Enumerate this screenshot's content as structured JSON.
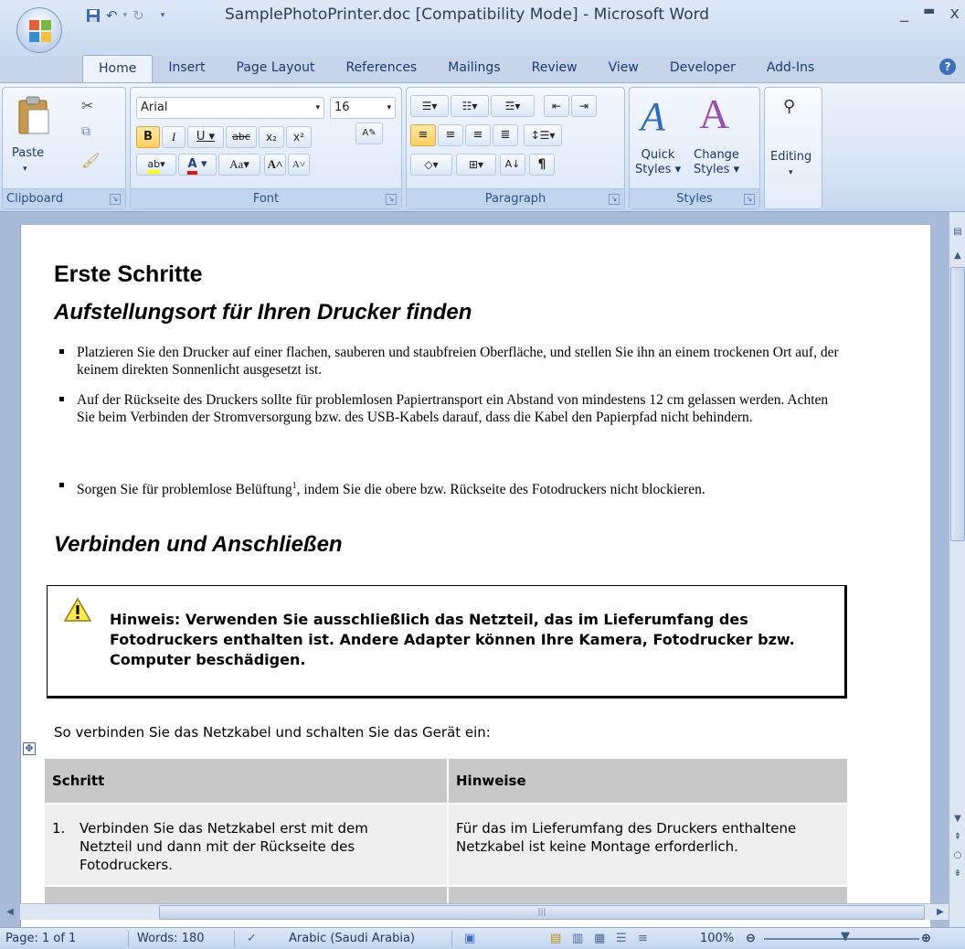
{
  "window": {
    "title": "SamplePhotoPrinter.doc [Compatibility Mode] - Microsoft Word",
    "controls": [
      "_",
      "▭",
      "x"
    ]
  },
  "tabs": [
    "Home",
    "Insert",
    "Page Layout",
    "References",
    "Mailings",
    "Review",
    "View",
    "Developer",
    "Add-Ins"
  ],
  "ribbon": {
    "clipboard": {
      "paste": "Paste",
      "label": "Clipboard"
    },
    "font": {
      "name": "Arial",
      "size": "16",
      "label": "Font",
      "aa": "Aa"
    },
    "paragraph": {
      "label": "Paragraph"
    },
    "styles": {
      "quick_line1": "Quick",
      "quick_line2": "Styles",
      "change_line1": "Change",
      "change_line2": "Styles",
      "label": "Styles"
    },
    "editing": {
      "label": "Editing"
    }
  },
  "document": {
    "heading1": "Erste Schritte",
    "heading2a": "Aufstellungsort für Ihren Drucker finden",
    "bullets": [
      "Platzieren Sie den Drucker auf einer flachen, sauberen und staubfreien Oberfläche, und stellen Sie ihn an einem trockenen Ort auf, der keinem direkten Sonnenlicht ausgesetzt ist.",
      "Auf der Rückseite des Druckers sollte für problemlosen Papiertransport ein Abstand von mindestens 12 cm gelassen werden. Achten Sie beim Verbinden der Stromversorgung bzw. des USB-Kabels darauf, dass die Kabel den Papierpfad nicht behindern.",
      "Sorgen Sie für problemlose Belüftung",
      "1",
      ", indem Sie die obere bzw. Rückseite des Fotodruckers nicht blockieren."
    ],
    "heading2b": "Verbinden und Anschließen",
    "note": "Hinweis: Verwenden Sie ausschließlich das Netzteil, das im Lieferumfang des Fotodruckers enthalten ist. Andere Adapter können Ihre Kamera, Fotodrucker bzw. Computer beschädigen.",
    "intro": "So verbinden Sie das Netzkabel und schalten Sie das Gerät ein:",
    "table": {
      "headers": [
        "Schritt",
        "Hinweise"
      ],
      "rows": [
        {
          "num": "1.",
          "step": "Verbinden Sie das Netzkabel erst mit dem Netzteil und dann mit der Rückseite des Fotodruckers.",
          "note": "Für das im Lieferumfang des Druckers enthaltene Netzkabel ist keine Montage erforderlich."
        }
      ]
    }
  },
  "status": {
    "page": "Page: 1 of 1",
    "words": "Words: 180",
    "language": "Arabic (Saudi Arabia)",
    "zoom": "100%"
  },
  "colors": {
    "ribbon": "#dae6f6",
    "accent": "#3a6fc2",
    "table_header": "#c8c8c8",
    "table_cell": "#efefef"
  }
}
